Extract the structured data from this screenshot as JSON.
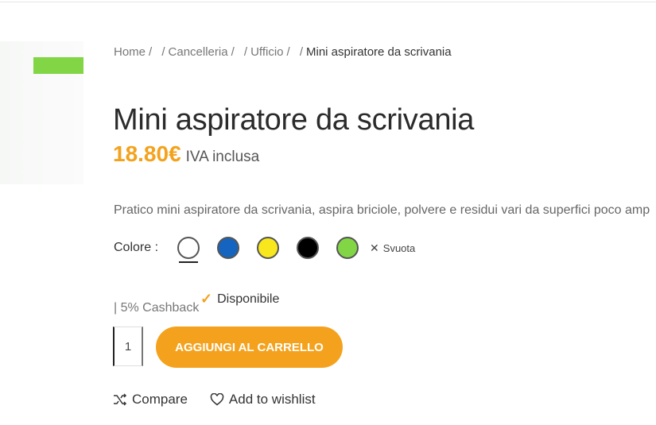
{
  "breadcrumb": {
    "items": [
      {
        "label": "Home"
      },
      {
        "label": "Cancelleria"
      },
      {
        "label": "Ufficio"
      }
    ],
    "current": "Mini aspiratore da scrivania",
    "separator": "/"
  },
  "product": {
    "title": "Mini aspiratore da scrivania",
    "price": "18.80€",
    "vat_note": "IVA inclusa",
    "description": "Pratico mini aspiratore da scrivania, aspira briciole, polvere e residui vari da superfici poco amp"
  },
  "variation": {
    "label": "Colore",
    "colon": ":",
    "swatches": [
      {
        "color": "#ffffff",
        "selected": true
      },
      {
        "color": "#1565c0",
        "selected": false
      },
      {
        "color": "#f8e71c",
        "selected": false
      },
      {
        "color": "#000000",
        "selected": false
      },
      {
        "color": "#82d646",
        "selected": false
      }
    ],
    "clear_label": "Svuota"
  },
  "stock": {
    "availability": "Disponibile",
    "cashback": "| 5% Cashback"
  },
  "cart": {
    "quantity": "1",
    "add_label": "AGGIUNGI AL CARRELLO"
  },
  "actions": {
    "compare_label": "Compare",
    "wishlist_label": "Add to wishlist"
  },
  "colors": {
    "accent": "#f4a21d",
    "badge_green": "#82d646"
  }
}
